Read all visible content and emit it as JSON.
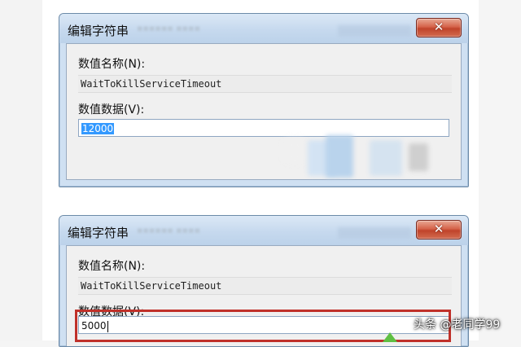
{
  "dialogs": [
    {
      "title": "编辑字符串",
      "name_label": "数值名称(N):",
      "name_value": "WaitToKillServiceTimeout",
      "data_label": "数值数据(V):",
      "data_value": "12000"
    },
    {
      "title": "编辑字符串",
      "name_label": "数值名称(N):",
      "name_value": "WaitToKillServiceTimeout",
      "data_label": "数值数据(V):",
      "data_value": "5000"
    }
  ],
  "watermark": "头条 @老同学99",
  "colors": {
    "titlebar": "#c6d9ee",
    "client": "#f0f0f0",
    "selection": "#3399ff",
    "highlight_border": "#c0312a",
    "arrow": "#5fbf43"
  },
  "icons": {
    "close": "close-icon",
    "arrow": "arrow-up-icon"
  }
}
